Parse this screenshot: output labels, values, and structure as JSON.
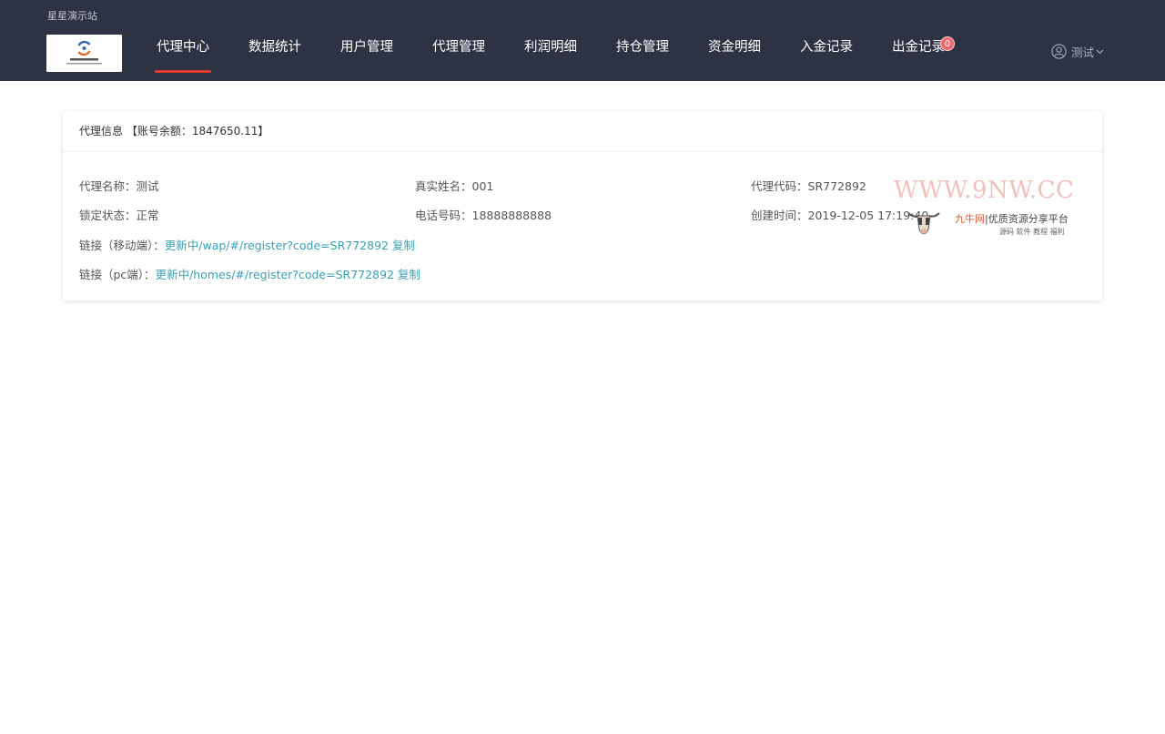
{
  "header": {
    "site_name": "星星演示站",
    "nav": [
      {
        "label": "代理中心",
        "active": true
      },
      {
        "label": "数据统计"
      },
      {
        "label": "用户管理"
      },
      {
        "label": "代理管理"
      },
      {
        "label": "利润明细"
      },
      {
        "label": "持仓管理"
      },
      {
        "label": "资金明细"
      },
      {
        "label": "入金记录"
      },
      {
        "label": "出金记录",
        "badge": "0"
      }
    ],
    "user": {
      "name": "测试",
      "icon": "user-circle-icon"
    }
  },
  "card": {
    "title": "代理信息 【账号余额：1847650.11】",
    "fields": {
      "agent_name_label": "代理名称：",
      "agent_name": "测试",
      "real_name_label": "真实姓名：",
      "real_name": "001",
      "agent_code_label": "代理代码：",
      "agent_code": "SR772892",
      "lock_status_label": "锁定状态：",
      "lock_status": "正常",
      "phone_label": "电话号码：",
      "phone": "18888888888",
      "created_label": "创建时间：",
      "created": "2019-12-05 17:19:40"
    },
    "links": {
      "mobile_label": "链接（移动端）：",
      "mobile_url": "更新中/wap/#/register?code=SR772892",
      "pc_label": "链接（pc端）：",
      "pc_url": "更新中/homes/#/register?code=SR772892",
      "copy_label": "复制"
    }
  },
  "watermark": {
    "text": "WWW.9NW.CC",
    "brand": "九牛网",
    "slogan": "优质资源分享平台",
    "tags": "源码 软件 教程 福利"
  },
  "colors": {
    "header_bg": "#2e3344",
    "active_underline": "#e0392b",
    "link": "#3b9fb0",
    "badge": "#ee6a6a"
  }
}
